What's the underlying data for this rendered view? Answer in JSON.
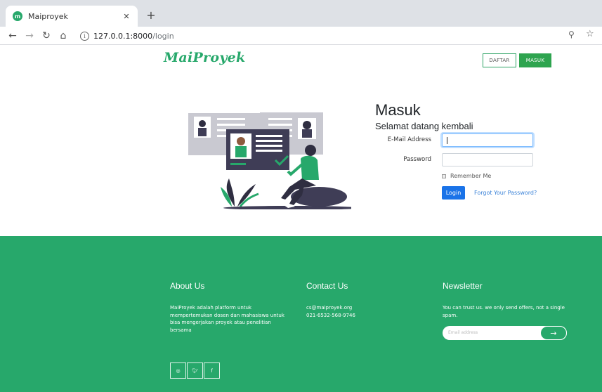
{
  "browser": {
    "tab_title": "Maiproyek",
    "favicon_letter": "m",
    "url_host": "127.0.0.1:8000",
    "url_path": "/login"
  },
  "header": {
    "brand": "MaiProyek",
    "daftar_label": "DAFTAR",
    "masuk_label": "MASUK"
  },
  "login": {
    "title": "Masuk",
    "subtitle": "Selamat datang kembali",
    "email_label": "E-Mail Address",
    "email_value": "",
    "password_label": "Password",
    "password_value": "",
    "remember_label": "Remember Me",
    "login_button": "Login",
    "forgot_link": "Forgot Your Password?"
  },
  "footer": {
    "about_heading": "About Us",
    "about_text": "MaiProyek adalah platform untuk mempertemukan dosen dan mahasiswa untuk bisa mengerjakan proyek atau penelitian bersama",
    "contact_heading": "Contact Us",
    "contact_email": "cs@maiproyek.org",
    "contact_phone": "021-6532-568-9746",
    "newsletter_heading": "Newsletter",
    "newsletter_text": "You can trust us. we only send offers, not a single spam.",
    "newsletter_placeholder": "Email address"
  },
  "icons": {
    "social": [
      "instagram-icon",
      "twitter-icon",
      "facebook-icon"
    ]
  },
  "colors": {
    "brand_green": "#27a86b",
    "login_blue": "#1a73e8",
    "link_blue": "#3a82d8"
  }
}
